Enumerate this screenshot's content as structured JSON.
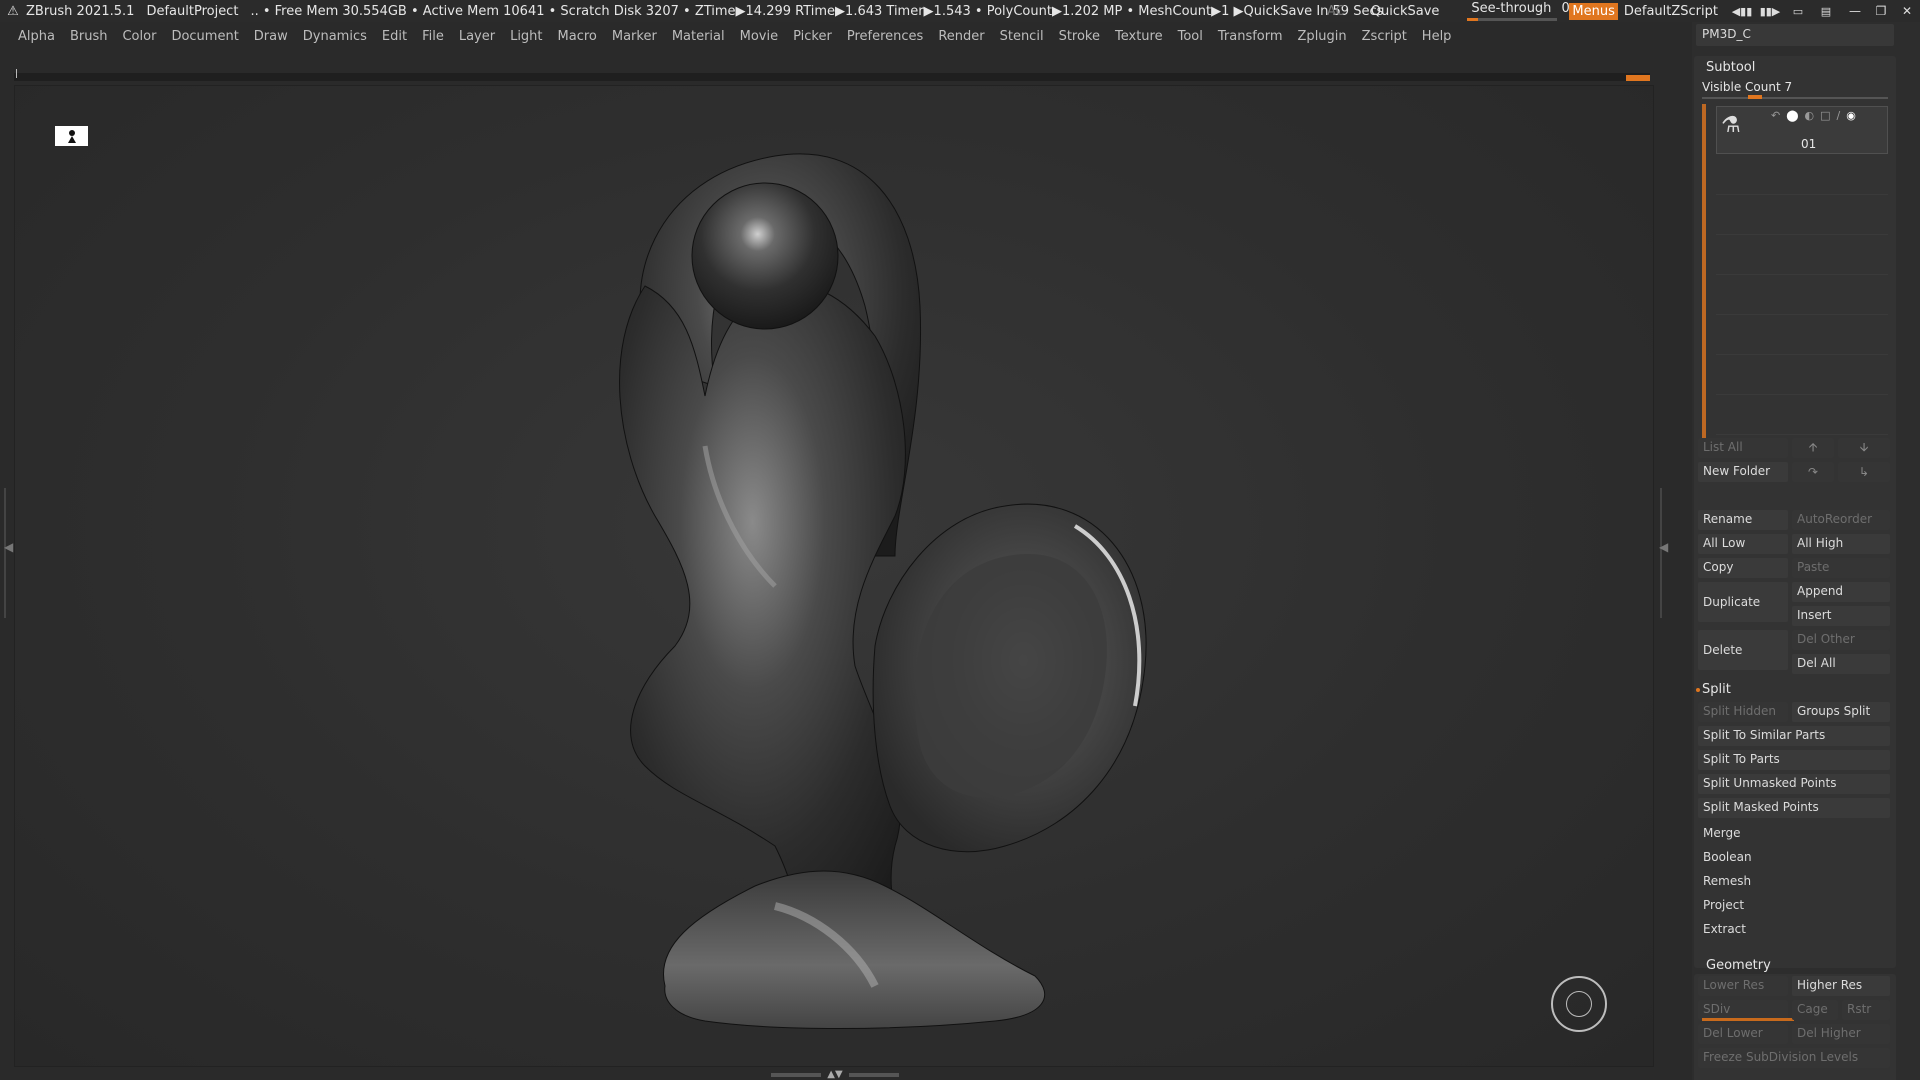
{
  "titlebar": {
    "app": "ZBrush 2021.5.1",
    "project": "DefaultProject",
    "status": ".. • Free Mem 30.554GB • Active Mem 10641 • Scratch Disk 3207 •  ZTime▶14.299 RTime▶1.643 Timer▶1.543 • PolyCount▶1.202 MP  • MeshCount▶1  ▶QuickSave In 59 Secs",
    "ac": "AC",
    "quicksave": "QuickSave",
    "seethrough_label": "See-through",
    "seethrough_value": "0",
    "seethrough_fraction": 0.12,
    "menus": "Menus",
    "script": "DefaultZScript"
  },
  "menubar": [
    "Alpha",
    "Brush",
    "Color",
    "Document",
    "Draw",
    "Dynamics",
    "Edit",
    "File",
    "Layer",
    "Light",
    "Macro",
    "Marker",
    "Material",
    "Movie",
    "Picker",
    "Preferences",
    "Render",
    "Stencil",
    "Stroke",
    "Texture",
    "Tool",
    "Transform",
    "Zplugin",
    "Zscript",
    "Help"
  ],
  "panel": {
    "tool_name": "PM3D_C",
    "subtool": {
      "title": "Subtool",
      "visible_count": "Visible Count 7",
      "item_name": "01",
      "list_all": "List All",
      "new_folder": "New Folder",
      "rename": "Rename",
      "autoreorder": "AutoReorder",
      "all_low": "All Low",
      "all_high": "All High",
      "copy": "Copy",
      "paste": "Paste",
      "duplicate": "Duplicate",
      "append": "Append",
      "insert": "Insert",
      "delete": "Delete",
      "del_other": "Del Other",
      "del_all": "Del All",
      "split": "Split",
      "split_hidden": "Split Hidden",
      "groups_split": "Groups Split",
      "split_similar": "Split To Similar Parts",
      "split_parts": "Split To Parts",
      "split_unmasked": "Split Unmasked Points",
      "split_masked": "Split Masked Points",
      "merge": "Merge",
      "boolean": "Boolean",
      "remesh": "Remesh",
      "project": "Project",
      "extract": "Extract"
    },
    "geometry": {
      "title": "Geometry",
      "lower_res": "Lower Res",
      "higher_res": "Higher Res",
      "sdiv": "SDiv",
      "cage": "Cage",
      "rstr": "Rstr",
      "del_lower": "Del Lower",
      "del_higher": "Del Higher",
      "freeze": "Freeze SubDivision Levels"
    }
  },
  "colors": {
    "accent": "#e0761f",
    "background": "#2a2a2a"
  }
}
